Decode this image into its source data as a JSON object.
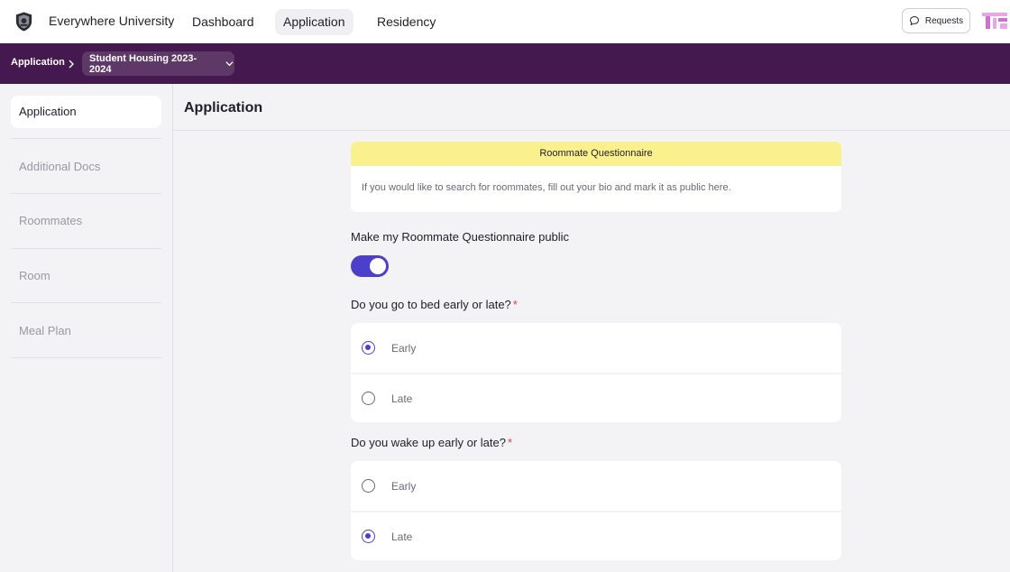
{
  "topnav": {
    "university": "Everywhere University",
    "items": [
      {
        "label": "Dashboard",
        "active": false
      },
      {
        "label": "Application",
        "active": true
      },
      {
        "label": "Residency",
        "active": false
      }
    ],
    "requests_label": "Requests"
  },
  "breadcrumb": {
    "root": "Application",
    "selected": "Student Housing 2023-2024"
  },
  "sidebar": {
    "items": [
      {
        "label": "Application",
        "active": true
      },
      {
        "label": "Additional Docs",
        "active": false
      },
      {
        "label": "Roommates",
        "active": false
      },
      {
        "label": "Room",
        "active": false
      },
      {
        "label": "Meal Plan",
        "active": false
      }
    ]
  },
  "main": {
    "title": "Application",
    "notice": {
      "heading": "Roommate Questionnaire",
      "body": "If you would like to search for roommates, fill out your bio and mark it as public here."
    },
    "toggle": {
      "label": "Make my Roommate Questionnaire public",
      "on": true
    },
    "questions": [
      {
        "text": "Do you go to bed early or late?",
        "required_mark": "*",
        "options": [
          {
            "label": "Early",
            "checked": true
          },
          {
            "label": "Late",
            "checked": false
          }
        ]
      },
      {
        "text": "Do you wake up early or late?",
        "required_mark": "*",
        "options": [
          {
            "label": "Early",
            "checked": false
          },
          {
            "label": "Late",
            "checked": true
          }
        ]
      }
    ]
  },
  "colors": {
    "brand_purple": "#44194f",
    "accent": "#4b3fcc",
    "notice_yellow": "#fbf08e",
    "required_red": "#d9463e"
  }
}
